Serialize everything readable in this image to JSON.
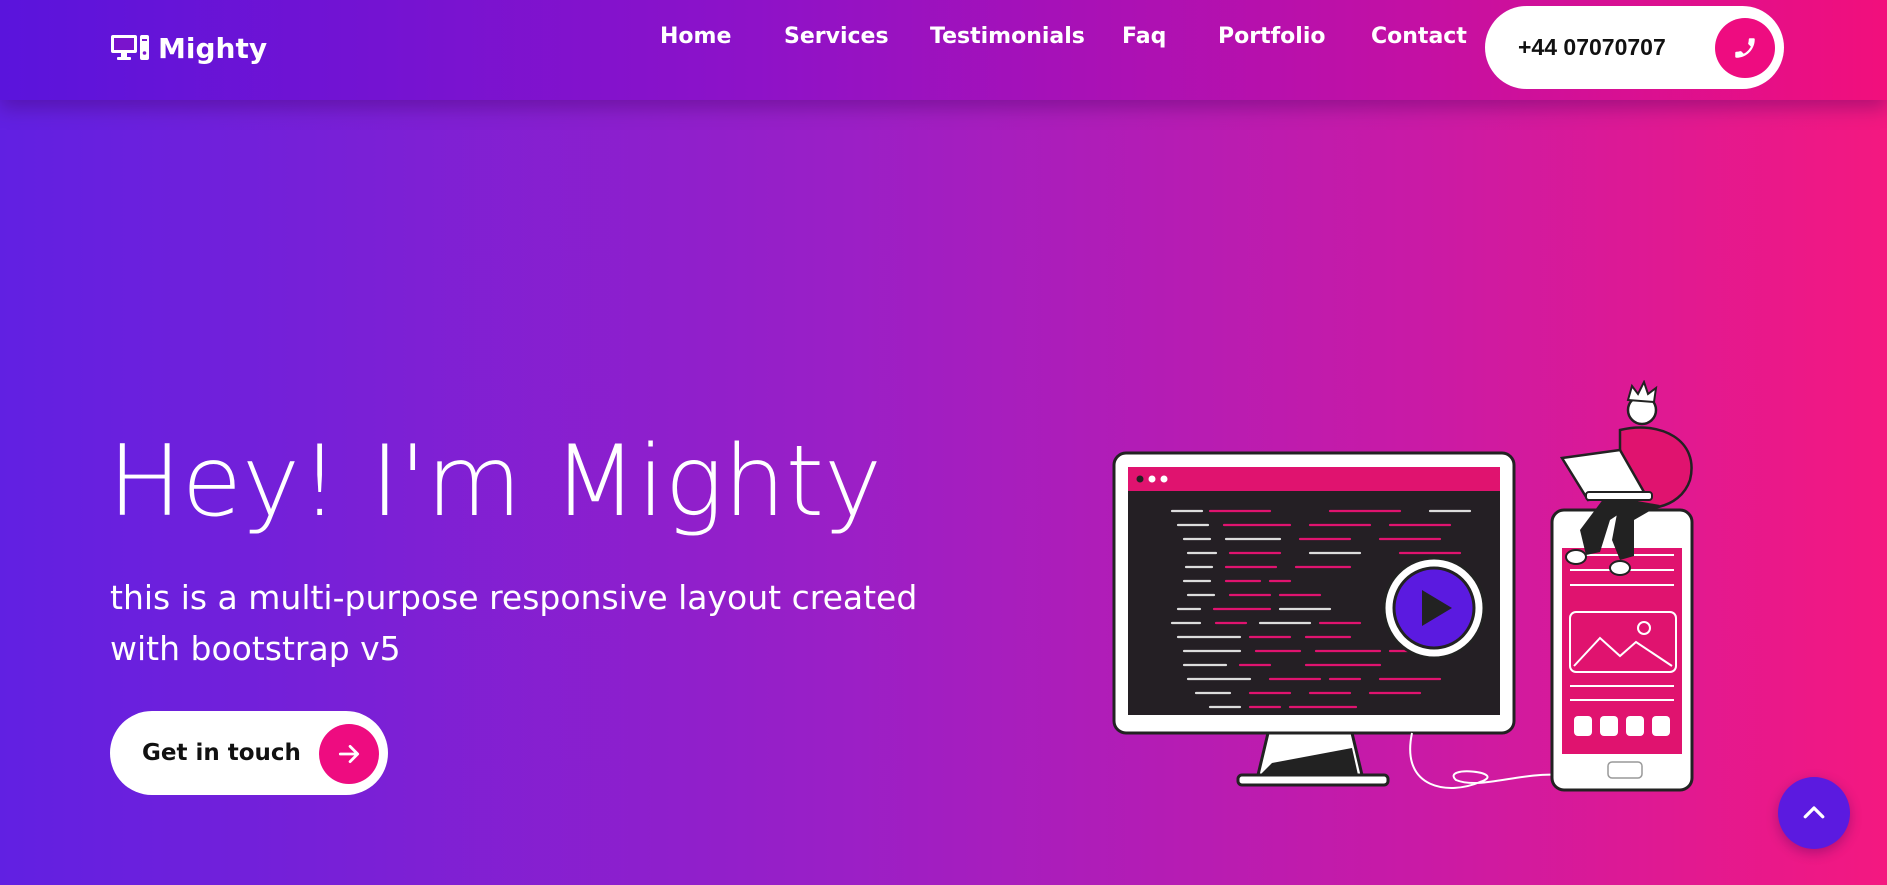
{
  "brand": {
    "name": "Mighty",
    "icon": "desktop-computer-icon"
  },
  "nav": {
    "items": [
      {
        "label": "Home"
      },
      {
        "label": "Services"
      },
      {
        "label": "Testimonials"
      },
      {
        "label": "Faq"
      },
      {
        "label": "Portfolio"
      },
      {
        "label": "Contact"
      }
    ],
    "phone": {
      "number": "+44 07070707",
      "icon": "phone-icon"
    }
  },
  "hero": {
    "title": "Hey! I'm Mighty",
    "subtitle": "this is a multi-purpose responsive layout created with bootstrap v5",
    "cta": {
      "label": "Get in touch",
      "icon": "arrow-right-icon"
    }
  },
  "scroll_top": {
    "icon": "chevron-up-icon"
  },
  "colors": {
    "accent": "#ee0c80",
    "gradient_start": "#6120e2",
    "gradient_end": "#f41880",
    "scroll_button": "#5b1ae0"
  }
}
